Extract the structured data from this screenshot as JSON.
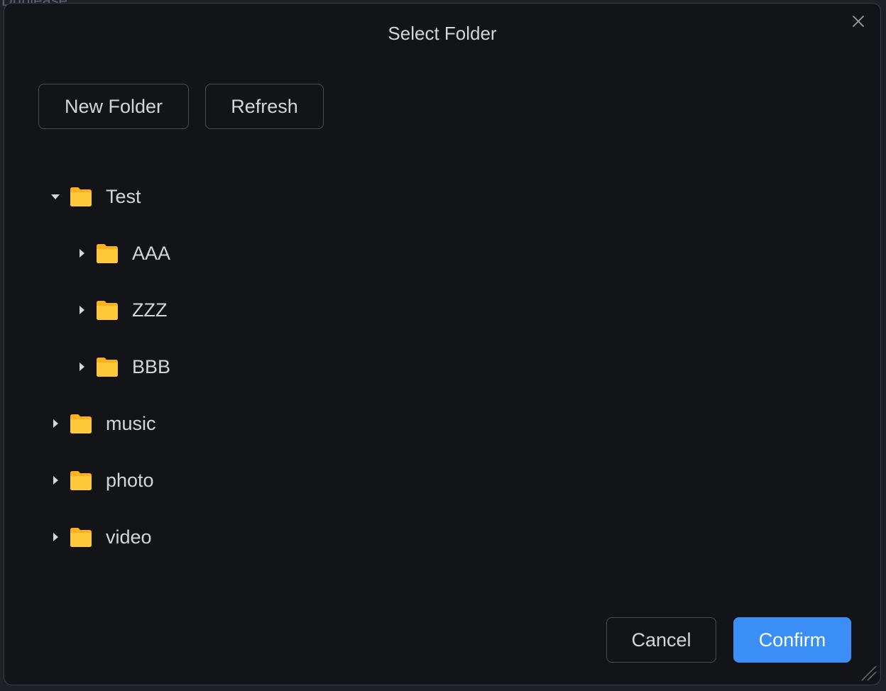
{
  "background": {
    "partial_text": "Dunlease"
  },
  "dialog": {
    "title": "Select Folder",
    "close_icon": "close-icon",
    "toolbar": {
      "new_folder_label": "New Folder",
      "refresh_label": "Refresh"
    },
    "tree": [
      {
        "label": "Test",
        "expanded": true,
        "level": 0
      },
      {
        "label": "AAA",
        "expanded": false,
        "level": 1
      },
      {
        "label": "ZZZ",
        "expanded": false,
        "level": 1
      },
      {
        "label": "BBB",
        "expanded": false,
        "level": 1
      },
      {
        "label": "music",
        "expanded": false,
        "level": 0
      },
      {
        "label": "photo",
        "expanded": false,
        "level": 0
      },
      {
        "label": "video",
        "expanded": false,
        "level": 0
      }
    ],
    "footer": {
      "cancel_label": "Cancel",
      "confirm_label": "Confirm"
    }
  },
  "colors": {
    "dialog_bg": "#131417",
    "accent": "#3a8ef6",
    "folder": "#fbc02d",
    "text": "#d4d5d8",
    "border": "#4a4d55"
  }
}
